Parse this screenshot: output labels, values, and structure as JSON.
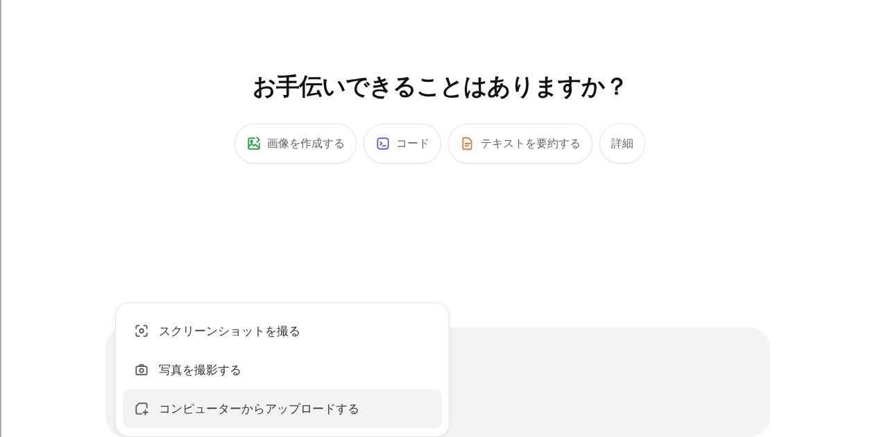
{
  "heading": "お手伝いできることはありますか？",
  "suggestions": [
    {
      "label": "画像を作成する",
      "kind": "image"
    },
    {
      "label": "コード",
      "kind": "code"
    },
    {
      "label": "テキストを要約する",
      "kind": "summary"
    },
    {
      "label": "詳細",
      "kind": "more"
    }
  ],
  "attach_menu": [
    {
      "label": "スクリーンショットを撮る",
      "kind": "screenshot",
      "selected": false
    },
    {
      "label": "写真を撮影する",
      "kind": "camera",
      "selected": false
    },
    {
      "label": "コンピューターからアップロードする",
      "kind": "upload",
      "selected": true
    }
  ]
}
